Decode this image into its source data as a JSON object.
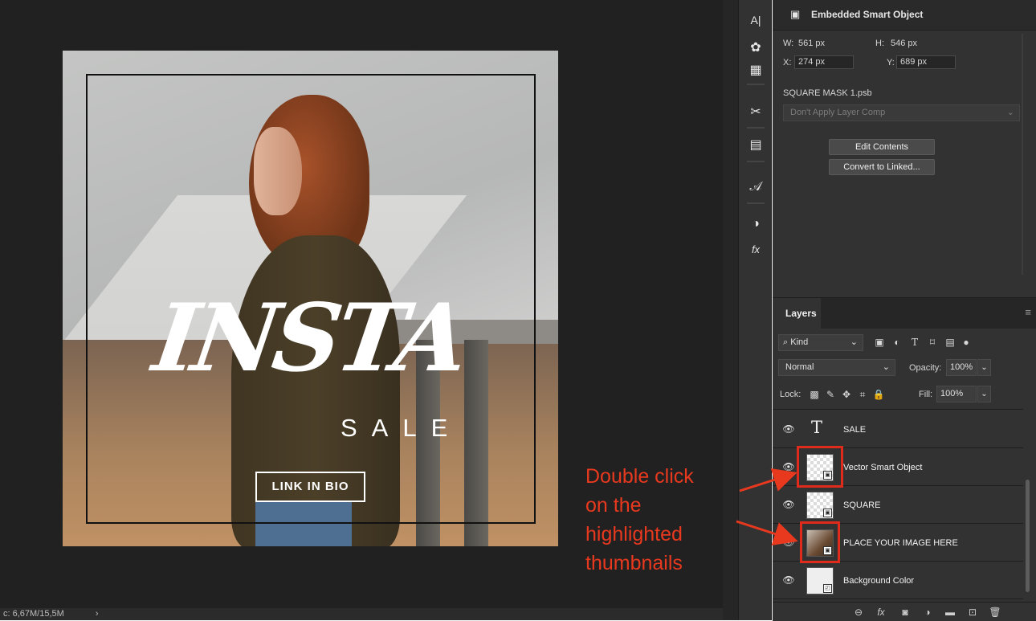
{
  "canvas": {
    "headline": "INSTA",
    "subheadline": "SALE",
    "cta": "LINK IN BIO",
    "status": "c: 6,67M/15,5M",
    "status_chevron": "›"
  },
  "annotation": {
    "lines": [
      "Double click",
      "on the",
      "highlighted",
      "thumbnails"
    ],
    "color": "#e8391f"
  },
  "iconbar": {
    "icons": [
      "character-icon",
      "color-palette-icon",
      "table-icon",
      "scissors-tool-icon",
      "paragraph-styles-icon",
      "glyphs-icon",
      "adjustments-icon",
      "fx-styles-icon"
    ],
    "glyphs": [
      "A|",
      "✿",
      "▦",
      "✂",
      "▤",
      "𝒜",
      "◑",
      "fx"
    ]
  },
  "properties": {
    "title": "Embedded Smart Object",
    "w_label": "W:",
    "w_value": "561 px",
    "h_label": "H:",
    "h_value": "546 px",
    "x_label": "X:",
    "x_value": "274 px",
    "y_label": "Y:",
    "y_value": "689 px",
    "filename": "SQUARE MASK 1.psb",
    "layer_comp": "Don't Apply Layer Comp",
    "edit_contents": "Edit Contents",
    "convert_linked": "Convert to Linked..."
  },
  "layers_panel": {
    "tab": "Layers",
    "kind": "Kind",
    "blend_mode": "Normal",
    "opacity_label": "Opacity:",
    "opacity_value": "100%",
    "lock_label": "Lock:",
    "fill_label": "Fill:",
    "fill_value": "100%",
    "layers": [
      {
        "name": "SALE",
        "type": "text",
        "visible": true
      },
      {
        "name": "Vector Smart Object",
        "type": "smart-object",
        "visible": true,
        "highlighted": true
      },
      {
        "name": "SQUARE",
        "type": "smart-object",
        "visible": true
      },
      {
        "name": "PLACE YOUR IMAGE HERE",
        "type": "photo",
        "visible": true,
        "highlighted": true
      },
      {
        "name": "Background Color",
        "type": "solid",
        "visible": true
      }
    ]
  },
  "colors": {
    "highlight": "#e02a1c",
    "panel_bg": "#323232",
    "canvas_bg": "#212121"
  }
}
